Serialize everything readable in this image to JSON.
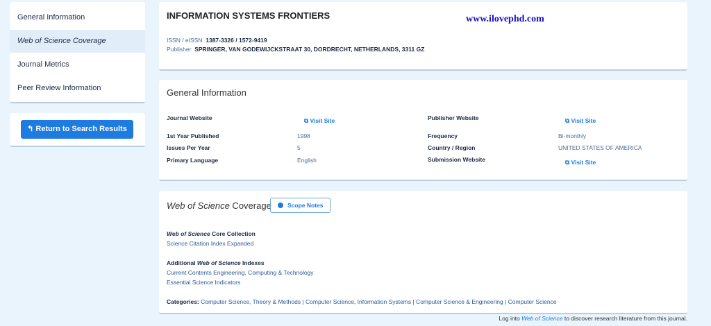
{
  "sidebar": {
    "items": [
      {
        "label": "General Information"
      },
      {
        "label": "Web of Science Coverage"
      },
      {
        "label": "Journal Metrics"
      },
      {
        "label": "Peer Review Information"
      }
    ],
    "return_label": "Return to Search Results"
  },
  "header": {
    "title": "INFORMATION SYSTEMS FRONTIERS",
    "watermark": "www.ilovephd.com",
    "issn_label": "ISSN / eISSN",
    "issn_value": "1387-3326 / 1572-9419",
    "publisher_label": "Publisher",
    "publisher_value": "SPRINGER, VAN GODEWIJCKSTRAAT 30, DORDRECHT, NETHERLANDS, 3311 GZ"
  },
  "general": {
    "title": "General Information",
    "visit_label": "Visit Site",
    "journal_website": "Journal Website",
    "publisher_website": "Publisher Website",
    "first_year_label": "1st Year Published",
    "first_year": "1998",
    "issues_label": "Issues Per Year",
    "issues": "5",
    "language_label": "Primary Language",
    "language": "English",
    "frequency_label": "Frequency",
    "frequency": "Bi-monthly",
    "country_label": "Country / Region",
    "country": "UNITED STATES OF AMERICA",
    "submission_label": "Submission Website"
  },
  "coverage": {
    "title_italic": "Web of Science",
    "title_rest": " Coverage",
    "scope_notes": "Scope Notes",
    "core_italic": "Web of Science",
    "core_rest": " Core Collection",
    "core_value": "Science Citation Index Expanded",
    "add_pre": "Additional ",
    "add_italic": "Web of Science",
    "add_rest": " Indexes",
    "indexes": [
      "Current Contents Engineering, Computing & Technology",
      "Essential Science Indicators"
    ],
    "categories_label": "Categories:",
    "categories": "Computer Science, Theory & Methods | Computer Science, Information Systems | Computer Science & Engineering | Computer Science"
  },
  "footer": {
    "pre": "Log into ",
    "link": "Web of Science",
    "post": " to discover research literature from this journal."
  },
  "colors": {
    "accent": "#1e7be0",
    "background": "#eaf4fc"
  }
}
